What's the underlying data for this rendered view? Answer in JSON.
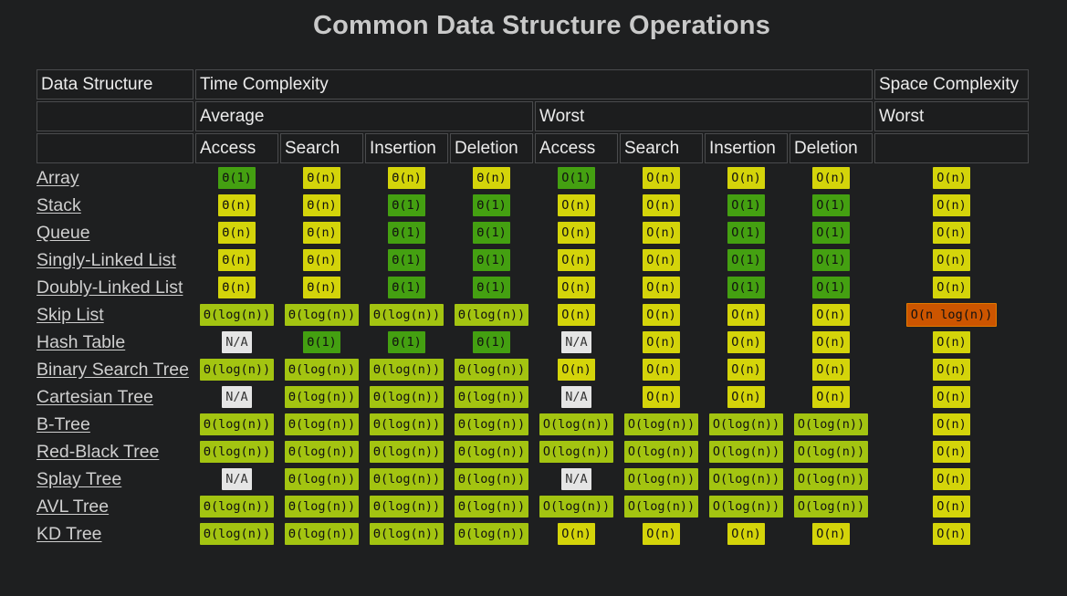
{
  "title": "Common Data Structure Operations",
  "colors": {
    "good": "#44a011",
    "fair": "#d4d40a",
    "ok": "#a3c411",
    "bad": "#cc5500",
    "na": "#e5e5e5"
  },
  "header": {
    "data_structure": "Data Structure",
    "time_complexity": "Time Complexity",
    "space_complexity": "Space Complexity",
    "average": "Average",
    "worst": "Worst",
    "space_worst": "Worst",
    "ops": [
      "Access",
      "Search",
      "Insertion",
      "Deletion",
      "Access",
      "Search",
      "Insertion",
      "Deletion"
    ]
  },
  "rows": [
    {
      "name": "Array",
      "cells": [
        [
          "Θ(1)",
          "good"
        ],
        [
          "Θ(n)",
          "fair"
        ],
        [
          "Θ(n)",
          "fair"
        ],
        [
          "Θ(n)",
          "fair"
        ],
        [
          "O(1)",
          "good"
        ],
        [
          "O(n)",
          "fair"
        ],
        [
          "O(n)",
          "fair"
        ],
        [
          "O(n)",
          "fair"
        ],
        [
          "O(n)",
          "fair"
        ]
      ]
    },
    {
      "name": "Stack",
      "cells": [
        [
          "Θ(n)",
          "fair"
        ],
        [
          "Θ(n)",
          "fair"
        ],
        [
          "Θ(1)",
          "good"
        ],
        [
          "Θ(1)",
          "good"
        ],
        [
          "O(n)",
          "fair"
        ],
        [
          "O(n)",
          "fair"
        ],
        [
          "O(1)",
          "good"
        ],
        [
          "O(1)",
          "good"
        ],
        [
          "O(n)",
          "fair"
        ]
      ]
    },
    {
      "name": "Queue",
      "cells": [
        [
          "Θ(n)",
          "fair"
        ],
        [
          "Θ(n)",
          "fair"
        ],
        [
          "Θ(1)",
          "good"
        ],
        [
          "Θ(1)",
          "good"
        ],
        [
          "O(n)",
          "fair"
        ],
        [
          "O(n)",
          "fair"
        ],
        [
          "O(1)",
          "good"
        ],
        [
          "O(1)",
          "good"
        ],
        [
          "O(n)",
          "fair"
        ]
      ]
    },
    {
      "name": "Singly-Linked List",
      "cells": [
        [
          "Θ(n)",
          "fair"
        ],
        [
          "Θ(n)",
          "fair"
        ],
        [
          "Θ(1)",
          "good"
        ],
        [
          "Θ(1)",
          "good"
        ],
        [
          "O(n)",
          "fair"
        ],
        [
          "O(n)",
          "fair"
        ],
        [
          "O(1)",
          "good"
        ],
        [
          "O(1)",
          "good"
        ],
        [
          "O(n)",
          "fair"
        ]
      ]
    },
    {
      "name": "Doubly-Linked List",
      "cells": [
        [
          "Θ(n)",
          "fair"
        ],
        [
          "Θ(n)",
          "fair"
        ],
        [
          "Θ(1)",
          "good"
        ],
        [
          "Θ(1)",
          "good"
        ],
        [
          "O(n)",
          "fair"
        ],
        [
          "O(n)",
          "fair"
        ],
        [
          "O(1)",
          "good"
        ],
        [
          "O(1)",
          "good"
        ],
        [
          "O(n)",
          "fair"
        ]
      ]
    },
    {
      "name": "Skip List",
      "cells": [
        [
          "Θ(log(n))",
          "ok"
        ],
        [
          "Θ(log(n))",
          "ok"
        ],
        [
          "Θ(log(n))",
          "ok"
        ],
        [
          "Θ(log(n))",
          "ok"
        ],
        [
          "O(n)",
          "fair"
        ],
        [
          "O(n)",
          "fair"
        ],
        [
          "O(n)",
          "fair"
        ],
        [
          "O(n)",
          "fair"
        ],
        [
          "O(n log(n))",
          "bad"
        ]
      ]
    },
    {
      "name": "Hash Table",
      "cells": [
        [
          "N/A",
          "na"
        ],
        [
          "Θ(1)",
          "good"
        ],
        [
          "Θ(1)",
          "good"
        ],
        [
          "Θ(1)",
          "good"
        ],
        [
          "N/A",
          "na"
        ],
        [
          "O(n)",
          "fair"
        ],
        [
          "O(n)",
          "fair"
        ],
        [
          "O(n)",
          "fair"
        ],
        [
          "O(n)",
          "fair"
        ]
      ]
    },
    {
      "name": "Binary Search Tree",
      "cells": [
        [
          "Θ(log(n))",
          "ok"
        ],
        [
          "Θ(log(n))",
          "ok"
        ],
        [
          "Θ(log(n))",
          "ok"
        ],
        [
          "Θ(log(n))",
          "ok"
        ],
        [
          "O(n)",
          "fair"
        ],
        [
          "O(n)",
          "fair"
        ],
        [
          "O(n)",
          "fair"
        ],
        [
          "O(n)",
          "fair"
        ],
        [
          "O(n)",
          "fair"
        ]
      ]
    },
    {
      "name": "Cartesian Tree",
      "cells": [
        [
          "N/A",
          "na"
        ],
        [
          "Θ(log(n))",
          "ok"
        ],
        [
          "Θ(log(n))",
          "ok"
        ],
        [
          "Θ(log(n))",
          "ok"
        ],
        [
          "N/A",
          "na"
        ],
        [
          "O(n)",
          "fair"
        ],
        [
          "O(n)",
          "fair"
        ],
        [
          "O(n)",
          "fair"
        ],
        [
          "O(n)",
          "fair"
        ]
      ]
    },
    {
      "name": "B-Tree",
      "cells": [
        [
          "Θ(log(n))",
          "ok"
        ],
        [
          "Θ(log(n))",
          "ok"
        ],
        [
          "Θ(log(n))",
          "ok"
        ],
        [
          "Θ(log(n))",
          "ok"
        ],
        [
          "O(log(n))",
          "ok"
        ],
        [
          "O(log(n))",
          "ok"
        ],
        [
          "O(log(n))",
          "ok"
        ],
        [
          "O(log(n))",
          "ok"
        ],
        [
          "O(n)",
          "fair"
        ]
      ]
    },
    {
      "name": "Red-Black Tree",
      "cells": [
        [
          "Θ(log(n))",
          "ok"
        ],
        [
          "Θ(log(n))",
          "ok"
        ],
        [
          "Θ(log(n))",
          "ok"
        ],
        [
          "Θ(log(n))",
          "ok"
        ],
        [
          "O(log(n))",
          "ok"
        ],
        [
          "O(log(n))",
          "ok"
        ],
        [
          "O(log(n))",
          "ok"
        ],
        [
          "O(log(n))",
          "ok"
        ],
        [
          "O(n)",
          "fair"
        ]
      ]
    },
    {
      "name": "Splay Tree",
      "cells": [
        [
          "N/A",
          "na"
        ],
        [
          "Θ(log(n))",
          "ok"
        ],
        [
          "Θ(log(n))",
          "ok"
        ],
        [
          "Θ(log(n))",
          "ok"
        ],
        [
          "N/A",
          "na"
        ],
        [
          "O(log(n))",
          "ok"
        ],
        [
          "O(log(n))",
          "ok"
        ],
        [
          "O(log(n))",
          "ok"
        ],
        [
          "O(n)",
          "fair"
        ]
      ]
    },
    {
      "name": "AVL Tree",
      "cells": [
        [
          "Θ(log(n))",
          "ok"
        ],
        [
          "Θ(log(n))",
          "ok"
        ],
        [
          "Θ(log(n))",
          "ok"
        ],
        [
          "Θ(log(n))",
          "ok"
        ],
        [
          "O(log(n))",
          "ok"
        ],
        [
          "O(log(n))",
          "ok"
        ],
        [
          "O(log(n))",
          "ok"
        ],
        [
          "O(log(n))",
          "ok"
        ],
        [
          "O(n)",
          "fair"
        ]
      ]
    },
    {
      "name": "KD Tree",
      "cells": [
        [
          "Θ(log(n))",
          "ok"
        ],
        [
          "Θ(log(n))",
          "ok"
        ],
        [
          "Θ(log(n))",
          "ok"
        ],
        [
          "Θ(log(n))",
          "ok"
        ],
        [
          "O(n)",
          "fair"
        ],
        [
          "O(n)",
          "fair"
        ],
        [
          "O(n)",
          "fair"
        ],
        [
          "O(n)",
          "fair"
        ],
        [
          "O(n)",
          "fair"
        ]
      ]
    }
  ]
}
